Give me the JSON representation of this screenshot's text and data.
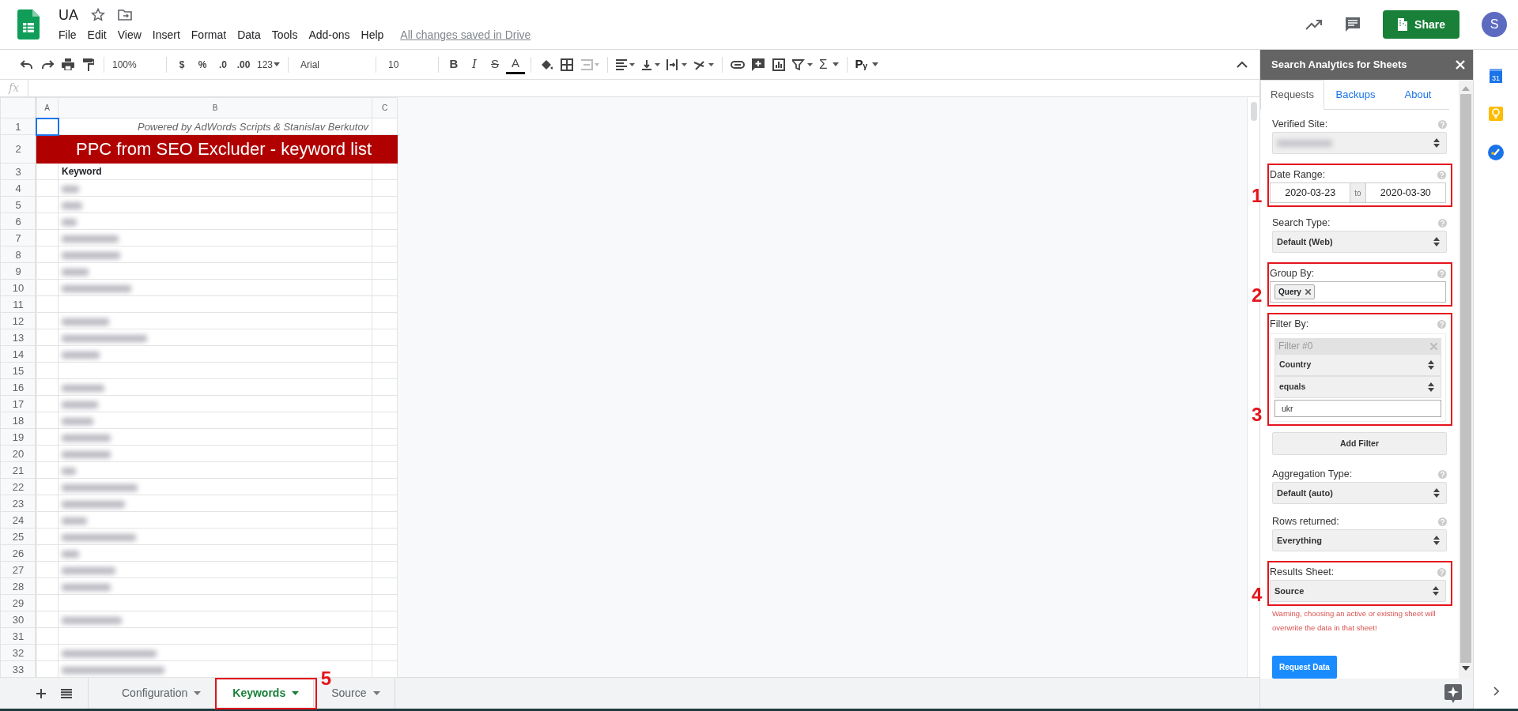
{
  "document": {
    "title": "UA",
    "save_status": "All changes saved in Drive"
  },
  "menu": [
    "File",
    "Edit",
    "View",
    "Insert",
    "Format",
    "Data",
    "Tools",
    "Add-ons",
    "Help"
  ],
  "share_button": "Share",
  "avatar": "S",
  "toolbar": {
    "zoom": "100%",
    "currency": "$",
    "percent": "%",
    "decrease_decimals": ".0",
    "increase_decimals": ".00",
    "more_formats": "123",
    "font": "Arial",
    "font_size": "10",
    "bold": "B",
    "italic": "I",
    "strikethrough": "S",
    "text_color": "A",
    "functions": "Σ",
    "addon": "Pᵧ"
  },
  "formula_bar": {
    "label": "fx"
  },
  "sheet": {
    "columns": [
      {
        "label": "A"
      },
      {
        "label": "B"
      },
      {
        "label": "C"
      }
    ],
    "rows": [
      {
        "number": "1",
        "kind": "credit",
        "text": "Powered by AdWords Scripts & Stanislav Berkutov"
      },
      {
        "number": "2",
        "kind": "title",
        "text": "PPC from SEO Excluder - keyword list"
      },
      {
        "number": "3",
        "kind": "header",
        "text": "Keyword"
      },
      {
        "number": "4",
        "kind": "blurred"
      },
      {
        "number": "5",
        "kind": "blurred"
      },
      {
        "number": "6",
        "kind": "blurred"
      },
      {
        "number": "7",
        "kind": "blurred"
      },
      {
        "number": "8",
        "kind": "blurred"
      },
      {
        "number": "9",
        "kind": "blurred"
      },
      {
        "number": "10",
        "kind": "blurred"
      },
      {
        "number": "11",
        "kind": "empty"
      },
      {
        "number": "12",
        "kind": "blurred"
      },
      {
        "number": "13",
        "kind": "blurred"
      },
      {
        "number": "14",
        "kind": "blurred"
      },
      {
        "number": "15",
        "kind": "empty"
      },
      {
        "number": "16",
        "kind": "blurred"
      },
      {
        "number": "17",
        "kind": "blurred"
      },
      {
        "number": "18",
        "kind": "blurred"
      },
      {
        "number": "19",
        "kind": "blurred"
      },
      {
        "number": "20",
        "kind": "blurred"
      },
      {
        "number": "21",
        "kind": "blurred"
      },
      {
        "number": "22",
        "kind": "blurred"
      },
      {
        "number": "23",
        "kind": "blurred"
      },
      {
        "number": "24",
        "kind": "blurred"
      },
      {
        "number": "25",
        "kind": "blurred"
      },
      {
        "number": "26",
        "kind": "blurred"
      },
      {
        "number": "27",
        "kind": "blurred"
      },
      {
        "number": "28",
        "kind": "blurred"
      },
      {
        "number": "29",
        "kind": "empty"
      },
      {
        "number": "30",
        "kind": "blurred"
      },
      {
        "number": "31",
        "kind": "empty"
      },
      {
        "number": "32",
        "kind": "blurred"
      },
      {
        "number": "33",
        "kind": "blurred"
      }
    ]
  },
  "sheet_tabs": [
    {
      "label": "Configuration",
      "selected": false
    },
    {
      "label": "Keywords",
      "selected": true,
      "annotation": "5"
    },
    {
      "label": "Source",
      "selected": false
    }
  ],
  "sidebar": {
    "title": "Search Analytics for Sheets",
    "tabs": [
      {
        "label": "Requests",
        "selected": true
      },
      {
        "label": "Backups",
        "selected": false
      },
      {
        "label": "About",
        "selected": false
      }
    ],
    "sections": [
      {
        "kind": "select",
        "label": "Verified Site:",
        "blurred": true
      },
      {
        "kind": "date_range",
        "label": "Date Range:",
        "start": "2020-03-23",
        "separator": "to",
        "end": "2020-03-30",
        "annotation": "1"
      },
      {
        "kind": "select",
        "label": "Search Type:",
        "value": "Default (Web)"
      },
      {
        "kind": "tags",
        "label": "Group By:",
        "tags": [
          "Query"
        ],
        "annotation": "2"
      },
      {
        "kind": "filters",
        "label": "Filter By:",
        "filters": [
          {
            "title": "Filter #0",
            "dimension": "Country",
            "operator": "equals",
            "expression": "ukr"
          }
        ],
        "annotation": "3",
        "add_button": "Add Filter"
      },
      {
        "kind": "select",
        "label": "Aggregation Type:",
        "value": "Default (auto)"
      },
      {
        "kind": "select",
        "label": "Rows returned:",
        "value": "Everything"
      },
      {
        "kind": "select",
        "label": "Results Sheet:",
        "value": "Source",
        "annotation": "4",
        "warning": "Warning, choosing an active or existing sheet will overwrite the data in that sheet!"
      }
    ],
    "submit_button": "Request Data"
  },
  "side_rail": {
    "calendar_day": "31"
  }
}
